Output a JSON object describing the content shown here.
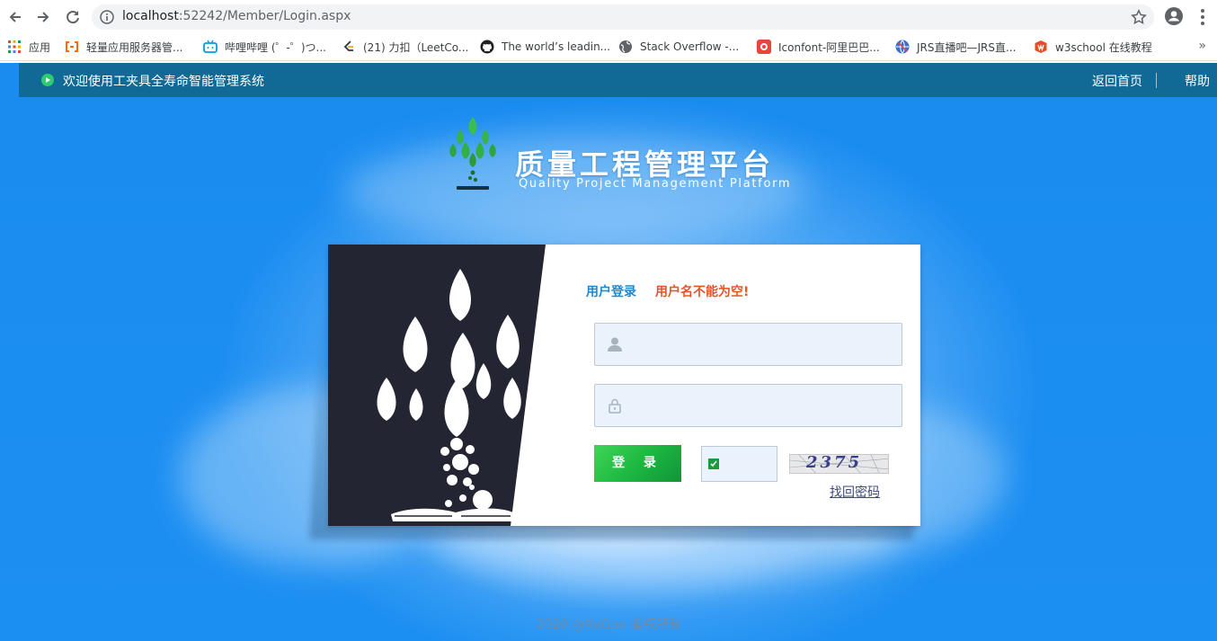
{
  "browser": {
    "url_host": "localhost",
    "url_rest": ":52242/Member/Login.aspx",
    "bookmarks": [
      {
        "label": "应用",
        "icon": "apps-grid-icon"
      },
      {
        "label": "轻量应用服务器管...",
        "icon": "aliyun-icon"
      },
      {
        "label": "哔哩哔哩 (゜-゜)つ...",
        "icon": "bilibili-icon"
      },
      {
        "label": "(21) 力扣（LeetCo...",
        "icon": "leetcode-icon"
      },
      {
        "label": "The world’s leadin...",
        "icon": "github-icon"
      },
      {
        "label": "Stack Overflow -...",
        "icon": "globe-icon"
      },
      {
        "label": "Iconfont-阿里巴巴...",
        "icon": "iconfont-icon"
      },
      {
        "label": "JRS直播吧—JRS直...",
        "icon": "jrs-icon"
      },
      {
        "label": "w3school 在线教程",
        "icon": "w3school-icon"
      }
    ],
    "more": "»"
  },
  "topbar": {
    "title": "欢迎使用工夹具全寿命智能管理系统",
    "home": "返回首页",
    "help": "帮助"
  },
  "brand": {
    "cn": "质量工程管理平台",
    "en": "Quality Project Management Platform"
  },
  "login": {
    "heading": "用户登录",
    "error": "用户名不能为空!",
    "username_value": "",
    "password_value": "",
    "captcha_value": "",
    "submit": "登 录",
    "captcha_text": "2375",
    "forgot": "找回密码"
  },
  "footer": "2020 @XuGuo 版权所有",
  "colors": {
    "page_bg": "#1b8ef0",
    "topbar": "#116a96",
    "accent": "#1e88d2",
    "error": "#e5552a",
    "button": "#1bb53f"
  }
}
